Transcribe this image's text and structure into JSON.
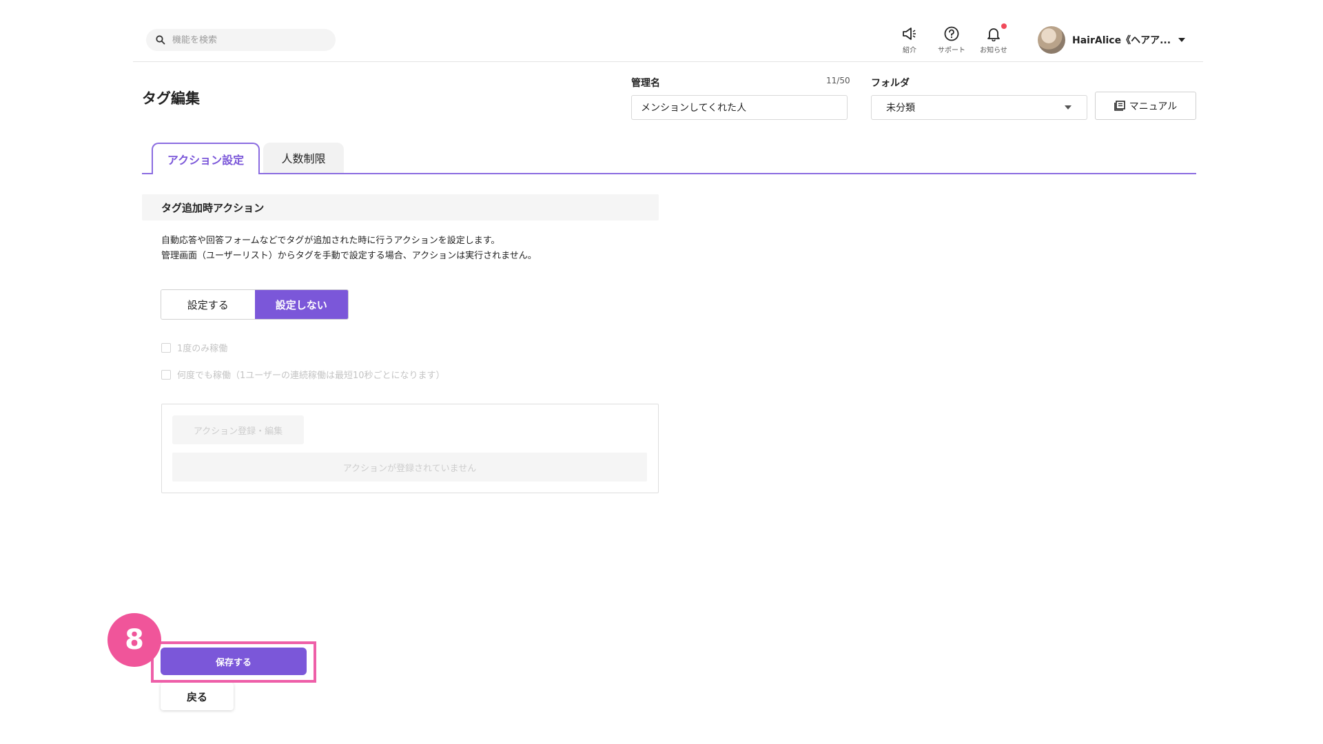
{
  "header": {
    "search_placeholder": "機能を検索",
    "icons": [
      {
        "name": "megaphone-icon",
        "label": "紹介"
      },
      {
        "name": "help-icon",
        "label": "サポート"
      },
      {
        "name": "bell-icon",
        "label": "お知らせ"
      }
    ],
    "account_name": "HairAlice《ヘアア..."
  },
  "page": {
    "title": "タグ編集",
    "admin_name_label": "管理名",
    "admin_name_counter": "11/50",
    "admin_name_value": "メンションしてくれた人",
    "folder_label": "フォルダ",
    "folder_value": "未分類",
    "manual_label": "マニュアル"
  },
  "tabs": [
    {
      "label": "アクション設定",
      "active": true
    },
    {
      "label": "人数制限",
      "active": false
    }
  ],
  "section": {
    "title": "タグ追加時アクション",
    "desc_line1": "自動応答や回答フォームなどでタグが追加された時に行うアクションを設定します。",
    "desc_line2": "管理画面（ユーザーリスト）からタグを手動で設定する場合、アクションは実行されません。",
    "toggle_on_label": "設定する",
    "toggle_off_label": "設定しない",
    "selected": "設定しない",
    "check_once": "1度のみ稼働",
    "check_many": "何度でも稼働（1ユーザーの連続稼働は最短10秒ごとになります）",
    "action_button": "アクション登録・編集",
    "empty_text": "アクションが登録されていません"
  },
  "footer": {
    "step_number": "8",
    "save_label": "保存する",
    "back_label": "戻る"
  },
  "colors": {
    "accent": "#7b57d9",
    "highlight": "#ee5fa8",
    "notification_dot": "#f04a5a"
  }
}
